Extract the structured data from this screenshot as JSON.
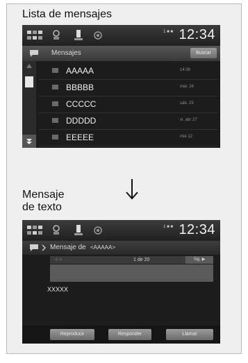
{
  "headings": {
    "list": "Lista de mensajes",
    "text_line1": "Mensaje",
    "text_line2": "de texto"
  },
  "screen1": {
    "clock": "12:34",
    "status_small": "1 ■ ■",
    "title": "Mensajes",
    "button": "Buscar",
    "messages": [
      {
        "name": "AAAAA",
        "date": "14:36"
      },
      {
        "name": "BBBBB",
        "date": "mar. 24"
      },
      {
        "name": "CCCCC",
        "date": "sáb. 25"
      },
      {
        "name": "DDDDD",
        "date": "vi. abr 27"
      },
      {
        "name": "EEEEE",
        "date": "mié 12"
      }
    ]
  },
  "screen2": {
    "clock": "12:34",
    "status_small": "1 ■ ■",
    "title": "Mensaje de",
    "sender": "<AAAAA>",
    "pager": "1 de 20",
    "next": "Sig. ▶",
    "prev": "◀ ◀",
    "body": "XXXXX",
    "buttons": [
      "Reproducir",
      "Responder",
      "Llamar"
    ]
  },
  "colors": {
    "screen_bg": "#1c1c1c",
    "text": "#f0f0f0",
    "button": "#8a8a8a"
  },
  "icons": [
    "messages-icon",
    "phone-icon",
    "bluetooth-icon",
    "settings-icon",
    "envelope-icon",
    "arrow-down-icon"
  ]
}
